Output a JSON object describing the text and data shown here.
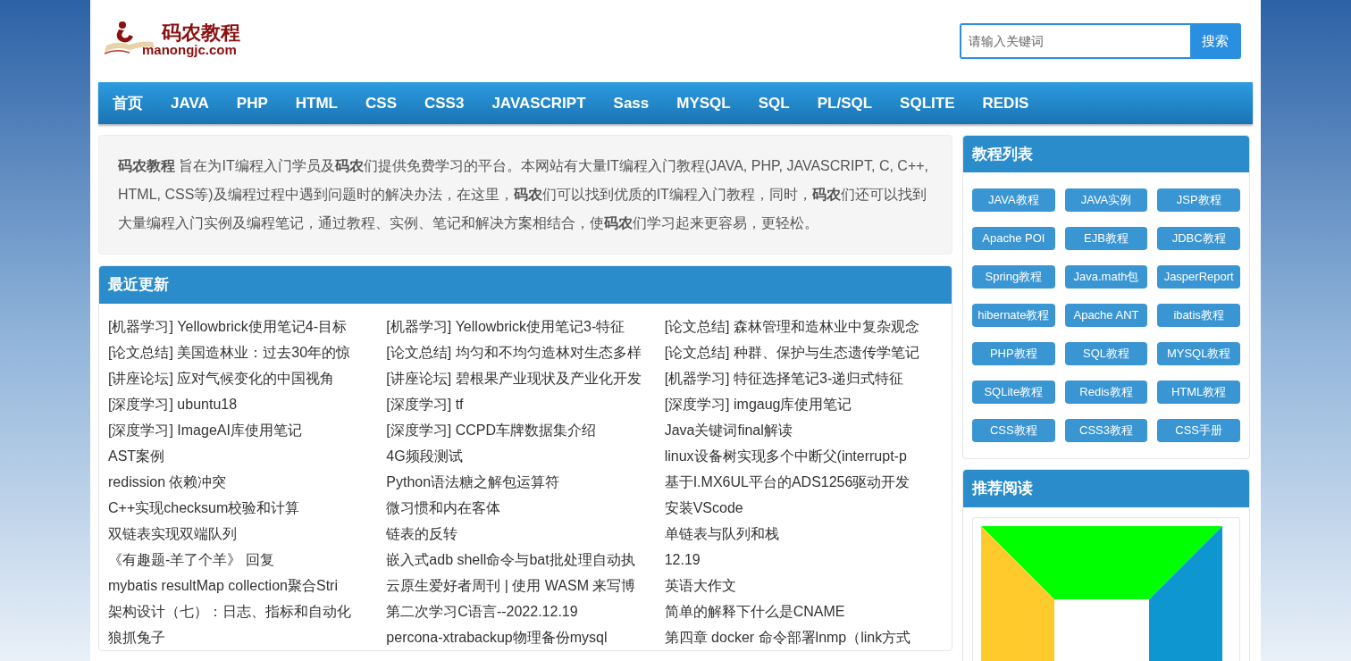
{
  "logo": {
    "title": "码农教程",
    "domain": "manongjc.com"
  },
  "search": {
    "placeholder": "请输入关键词",
    "button": "搜索"
  },
  "nav": [
    "首页",
    "JAVA",
    "PHP",
    "HTML",
    "CSS",
    "CSS3",
    "JAVASCRIPT",
    "Sass",
    "MYSQL",
    "SQL",
    "PL/SQL",
    "SQLITE",
    "REDIS"
  ],
  "intro": "**码农教程** 旨在为IT编程入门学员及**码农**们提供免费学习的平台。本网站有大量IT编程入门教程(JAVA, PHP, JAVASCRIPT, C, C++, HTML, CSS等)及编程过程中遇到问题时的解决办法，在这里，**码农**们可以找到优质的IT编程入门教程，同时，**码农**们还可以找到大量编程入门实例及编程笔记，通过教程、实例、笔记和解决方案相结合，使**码农**们学习起来更容易，更轻松。",
  "recent": {
    "title": "最近更新",
    "items": [
      "[机器学习] Yellowbrick使用笔记4-目标",
      "[机器学习] Yellowbrick使用笔记3-特征",
      "[论文总结] 森林管理和造林业中复杂观念",
      "[论文总结] 美国造林业：过去30年的惊",
      "[论文总结] 均匀和不均匀造林对生态多样",
      "[论文总结] 种群、保护与生态遗传学笔记",
      "[讲座论坛] 应对气候变化的中国视角",
      "[讲座论坛] 碧根果产业现状及产业化开发",
      "[机器学习] 特征选择笔记3-递归式特征",
      "[深度学习] ubuntu18",
      "[深度学习] tf",
      "[深度学习] imgaug库使用笔记",
      "[深度学习] ImageAI库使用笔记",
      "[深度学习] CCPD车牌数据集介绍",
      "Java关键词final解读",
      "AST案例",
      "4G频段测试",
      "linux设备树实现多个中断父(interrupt-p",
      "redission 依赖冲突",
      "Python语法糖之解包运算符",
      "基于I.MX6UL平台的ADS1256驱动开发",
      "C++实现checksum校验和计算",
      "微习惯和内在客体",
      "安装VScode",
      "双链表实现双端队列",
      "链表的反转",
      "单链表与队列和栈",
      "《有趣题-羊了个羊》 回复",
      "嵌入式adb shell命令与bat批处理自动执",
      "12.19",
      "mybatis resultMap collection聚合Stri",
      "云原生爱好者周刊 | 使用 WASM 来写博",
      "英语大作文",
      "架构设计（七）：日志、指标和自动化",
      "第二次学习C语言--2022.12.19",
      "简单的解释下什么是CNAME",
      "狼抓兔子",
      "percona-xtrabackup物理备份mysql",
      "第四章 docker 命令部署lnmp（link方式"
    ]
  },
  "tutorials": {
    "title": "教程列表",
    "items": [
      "JAVA教程",
      "JAVA实例",
      "JSP教程",
      "Apache POI",
      "EJB教程",
      "JDBC教程",
      "Spring教程",
      "Java.math包",
      "JasperReport",
      "hibernate教程",
      "Apache ANT",
      "ibatis教程",
      "PHP教程",
      "SQL教程",
      "MYSQL教程",
      "SQLite教程",
      "Redis教程",
      "HTML教程",
      "CSS教程",
      "CSS3教程",
      "CSS手册"
    ]
  },
  "recommended": {
    "title": "推荐阅读"
  }
}
